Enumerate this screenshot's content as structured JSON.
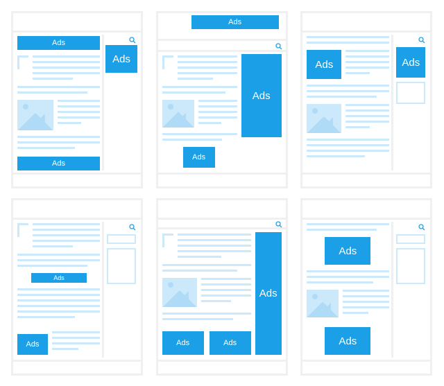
{
  "meta": {
    "description": "Six webpage layout wireframes showing different advertisement placements",
    "grid": "2 rows × 3 columns",
    "colors": {
      "ad_fill": "#1ba0e8",
      "placeholder": "#cce8fb",
      "frame": "#f0f0f0",
      "text_on_ad": "#ffffff"
    }
  },
  "labels": {
    "ad_small": "Ads",
    "ad_large": "Ads"
  },
  "layouts": [
    {
      "name": "layout-1",
      "ads": [
        "top-banner",
        "right-rectangle",
        "bottom-banner"
      ]
    },
    {
      "name": "layout-2",
      "ads": [
        "above-header-banner",
        "tall-right-rectangle",
        "inline-square"
      ]
    },
    {
      "name": "layout-3",
      "ads": [
        "inline-left-square",
        "right-sidebar-square"
      ]
    },
    {
      "name": "layout-4",
      "ads": [
        "mid-content-banner",
        "bottom-left-square"
      ]
    },
    {
      "name": "layout-5",
      "ads": [
        "right-skyscraper",
        "bottom-square-1",
        "bottom-square-2"
      ]
    },
    {
      "name": "layout-6",
      "ads": [
        "top-content-square",
        "bottom-content-square"
      ]
    }
  ]
}
